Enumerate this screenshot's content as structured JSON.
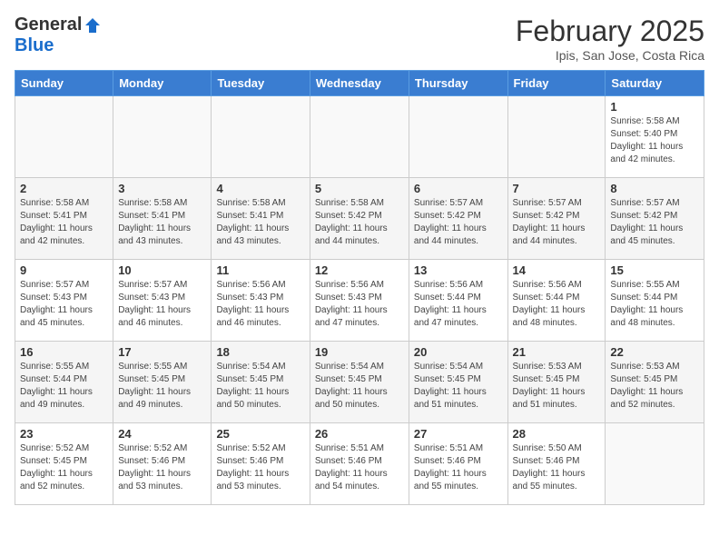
{
  "header": {
    "logo_general": "General",
    "logo_blue": "Blue",
    "month_title": "February 2025",
    "subtitle": "Ipis, San Jose, Costa Rica"
  },
  "days_of_week": [
    "Sunday",
    "Monday",
    "Tuesday",
    "Wednesday",
    "Thursday",
    "Friday",
    "Saturday"
  ],
  "weeks": [
    [
      {
        "day": "",
        "info": ""
      },
      {
        "day": "",
        "info": ""
      },
      {
        "day": "",
        "info": ""
      },
      {
        "day": "",
        "info": ""
      },
      {
        "day": "",
        "info": ""
      },
      {
        "day": "",
        "info": ""
      },
      {
        "day": "1",
        "info": "Sunrise: 5:58 AM\nSunset: 5:40 PM\nDaylight: 11 hours\nand 42 minutes."
      }
    ],
    [
      {
        "day": "2",
        "info": "Sunrise: 5:58 AM\nSunset: 5:41 PM\nDaylight: 11 hours\nand 42 minutes."
      },
      {
        "day": "3",
        "info": "Sunrise: 5:58 AM\nSunset: 5:41 PM\nDaylight: 11 hours\nand 43 minutes."
      },
      {
        "day": "4",
        "info": "Sunrise: 5:58 AM\nSunset: 5:41 PM\nDaylight: 11 hours\nand 43 minutes."
      },
      {
        "day": "5",
        "info": "Sunrise: 5:58 AM\nSunset: 5:42 PM\nDaylight: 11 hours\nand 44 minutes."
      },
      {
        "day": "6",
        "info": "Sunrise: 5:57 AM\nSunset: 5:42 PM\nDaylight: 11 hours\nand 44 minutes."
      },
      {
        "day": "7",
        "info": "Sunrise: 5:57 AM\nSunset: 5:42 PM\nDaylight: 11 hours\nand 44 minutes."
      },
      {
        "day": "8",
        "info": "Sunrise: 5:57 AM\nSunset: 5:42 PM\nDaylight: 11 hours\nand 45 minutes."
      }
    ],
    [
      {
        "day": "9",
        "info": "Sunrise: 5:57 AM\nSunset: 5:43 PM\nDaylight: 11 hours\nand 45 minutes."
      },
      {
        "day": "10",
        "info": "Sunrise: 5:57 AM\nSunset: 5:43 PM\nDaylight: 11 hours\nand 46 minutes."
      },
      {
        "day": "11",
        "info": "Sunrise: 5:56 AM\nSunset: 5:43 PM\nDaylight: 11 hours\nand 46 minutes."
      },
      {
        "day": "12",
        "info": "Sunrise: 5:56 AM\nSunset: 5:43 PM\nDaylight: 11 hours\nand 47 minutes."
      },
      {
        "day": "13",
        "info": "Sunrise: 5:56 AM\nSunset: 5:44 PM\nDaylight: 11 hours\nand 47 minutes."
      },
      {
        "day": "14",
        "info": "Sunrise: 5:56 AM\nSunset: 5:44 PM\nDaylight: 11 hours\nand 48 minutes."
      },
      {
        "day": "15",
        "info": "Sunrise: 5:55 AM\nSunset: 5:44 PM\nDaylight: 11 hours\nand 48 minutes."
      }
    ],
    [
      {
        "day": "16",
        "info": "Sunrise: 5:55 AM\nSunset: 5:44 PM\nDaylight: 11 hours\nand 49 minutes."
      },
      {
        "day": "17",
        "info": "Sunrise: 5:55 AM\nSunset: 5:45 PM\nDaylight: 11 hours\nand 49 minutes."
      },
      {
        "day": "18",
        "info": "Sunrise: 5:54 AM\nSunset: 5:45 PM\nDaylight: 11 hours\nand 50 minutes."
      },
      {
        "day": "19",
        "info": "Sunrise: 5:54 AM\nSunset: 5:45 PM\nDaylight: 11 hours\nand 50 minutes."
      },
      {
        "day": "20",
        "info": "Sunrise: 5:54 AM\nSunset: 5:45 PM\nDaylight: 11 hours\nand 51 minutes."
      },
      {
        "day": "21",
        "info": "Sunrise: 5:53 AM\nSunset: 5:45 PM\nDaylight: 11 hours\nand 51 minutes."
      },
      {
        "day": "22",
        "info": "Sunrise: 5:53 AM\nSunset: 5:45 PM\nDaylight: 11 hours\nand 52 minutes."
      }
    ],
    [
      {
        "day": "23",
        "info": "Sunrise: 5:52 AM\nSunset: 5:45 PM\nDaylight: 11 hours\nand 52 minutes."
      },
      {
        "day": "24",
        "info": "Sunrise: 5:52 AM\nSunset: 5:46 PM\nDaylight: 11 hours\nand 53 minutes."
      },
      {
        "day": "25",
        "info": "Sunrise: 5:52 AM\nSunset: 5:46 PM\nDaylight: 11 hours\nand 53 minutes."
      },
      {
        "day": "26",
        "info": "Sunrise: 5:51 AM\nSunset: 5:46 PM\nDaylight: 11 hours\nand 54 minutes."
      },
      {
        "day": "27",
        "info": "Sunrise: 5:51 AM\nSunset: 5:46 PM\nDaylight: 11 hours\nand 55 minutes."
      },
      {
        "day": "28",
        "info": "Sunrise: 5:50 AM\nSunset: 5:46 PM\nDaylight: 11 hours\nand 55 minutes."
      },
      {
        "day": "",
        "info": ""
      }
    ]
  ]
}
